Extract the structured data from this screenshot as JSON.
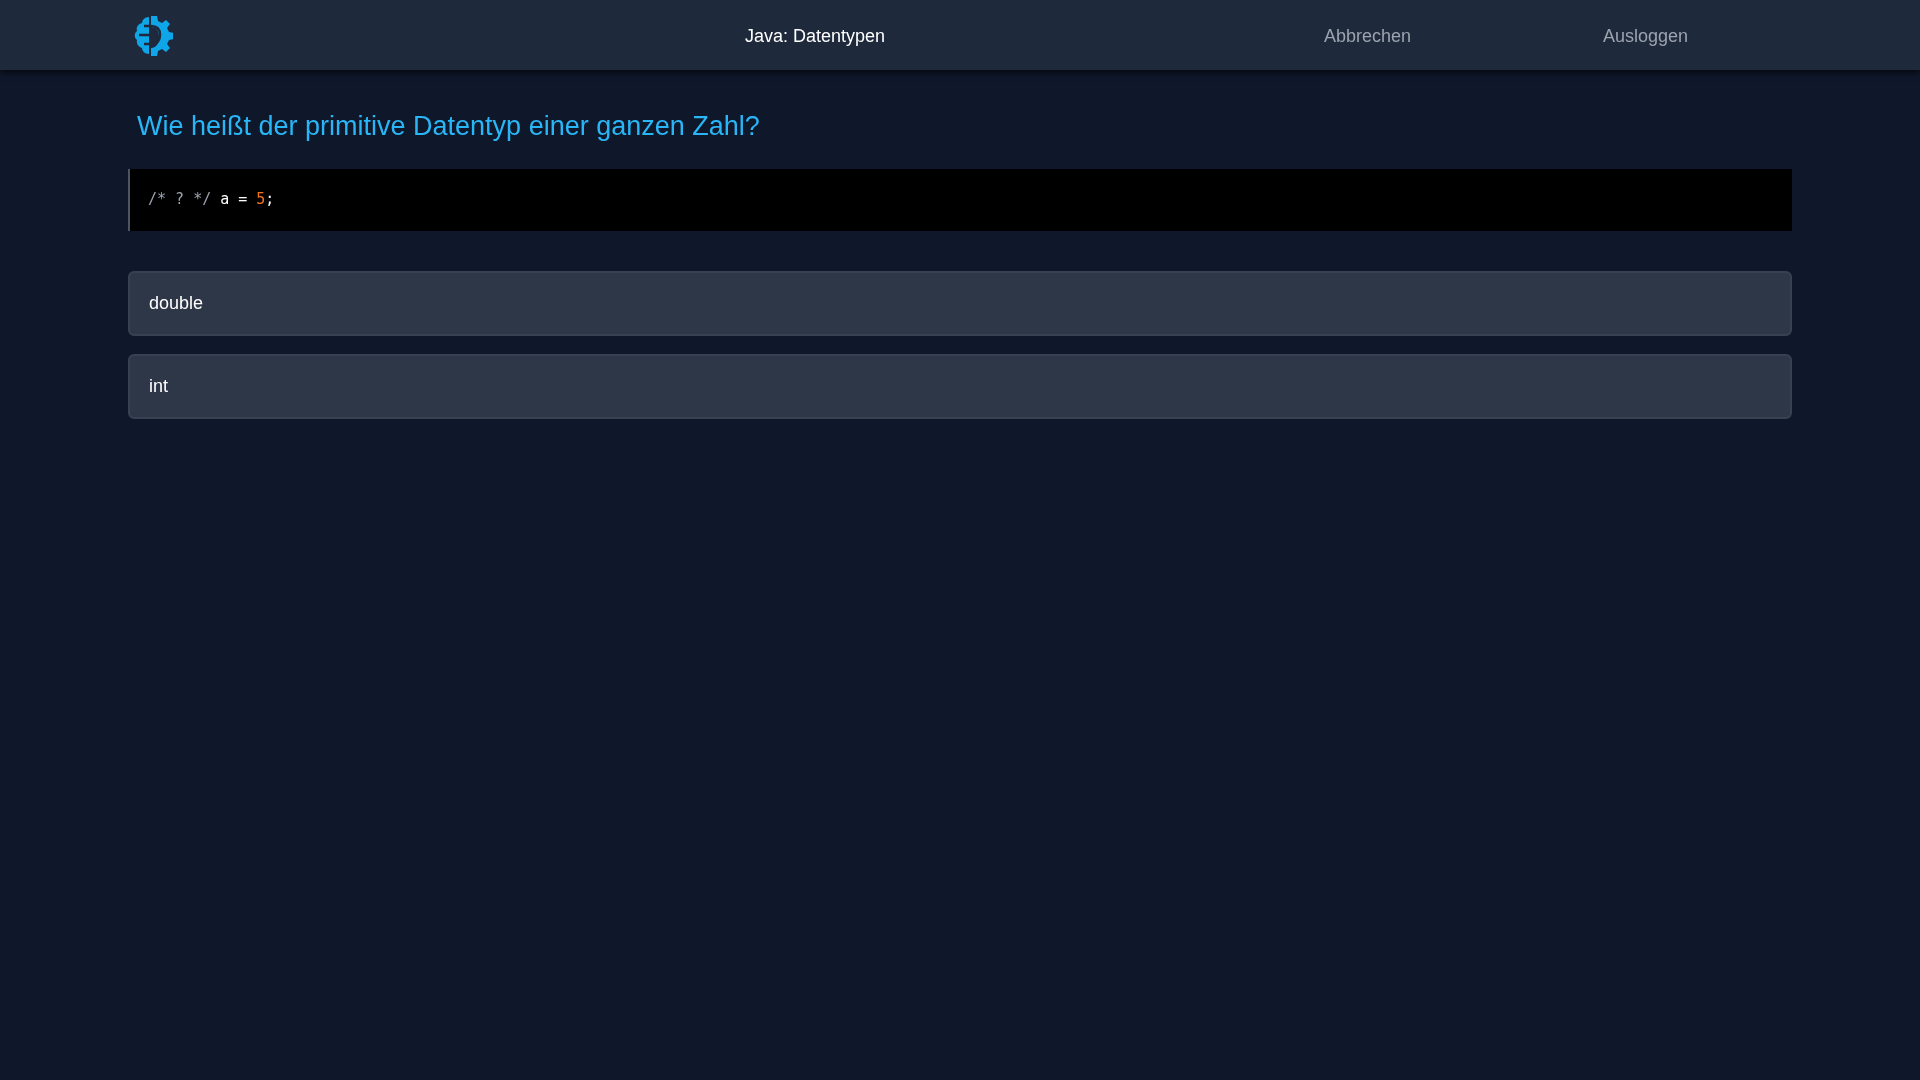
{
  "header": {
    "title": "Java: Datentypen",
    "links": [
      "Abbrechen",
      "Ausloggen"
    ]
  },
  "question": "Wie heißt der primitive Datentyp einer ganzen Zahl?",
  "code": [
    {
      "kind": "comment",
      "text": "/* ? */"
    },
    {
      "kind": "plain",
      "text": "a ="
    },
    {
      "kind": "number",
      "text": "5"
    },
    {
      "kind": "punct",
      "text": ";"
    }
  ],
  "answers": [
    "double",
    "int"
  ]
}
